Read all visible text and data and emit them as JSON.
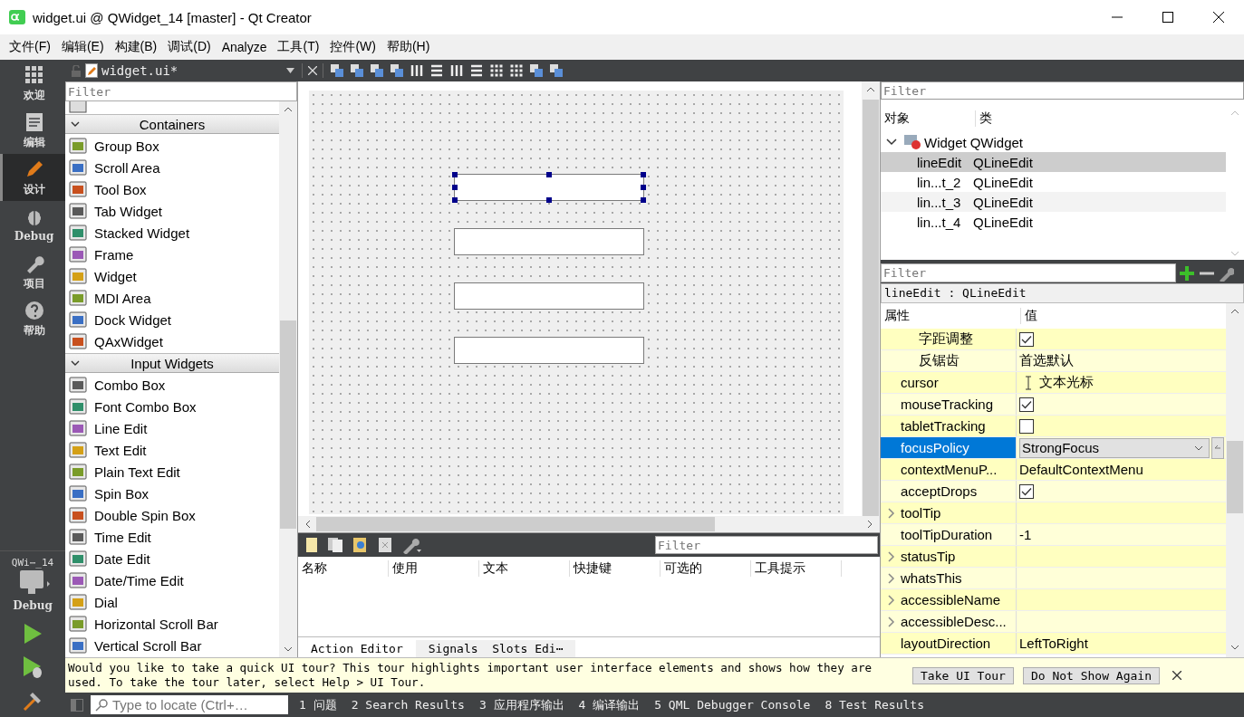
{
  "window": {
    "title": "widget.ui @ QWidget_14 [master] - Qt Creator"
  },
  "menu": [
    "文件(F)",
    "编辑(E)",
    "构建(B)",
    "调试(D)",
    "Analyze",
    "工具(T)",
    "控件(W)",
    "帮助(H)"
  ],
  "modes": [
    {
      "label": "欢迎",
      "selected": false
    },
    {
      "label": "编辑",
      "selected": false
    },
    {
      "label": "设计",
      "selected": true
    },
    {
      "label": "Debug",
      "selected": false
    },
    {
      "label": "项目",
      "selected": false
    },
    {
      "label": "帮助",
      "selected": false
    }
  ],
  "kit": {
    "project": "QWi⋯_14",
    "build": "Debug"
  },
  "editor": {
    "file": "widget.ui*"
  },
  "widget_box": {
    "filter_placeholder": "Filter",
    "categories": [
      {
        "name": "Containers",
        "expanded": true,
        "items": [
          "Group Box",
          "Scroll Area",
          "Tool Box",
          "Tab Widget",
          "Stacked Widget",
          "Frame",
          "Widget",
          "MDI Area",
          "Dock Widget",
          "QAxWidget"
        ]
      },
      {
        "name": "Input Widgets",
        "expanded": true,
        "items": [
          "Combo Box",
          "Font Combo Box",
          "Line Edit",
          "Text Edit",
          "Plain Text Edit",
          "Spin Box",
          "Double Spin Box",
          "Time Edit",
          "Date Edit",
          "Date/Time Edit",
          "Dial",
          "Horizontal Scroll Bar",
          "Vertical Scroll Bar"
        ]
      }
    ]
  },
  "form": {
    "line_edits": [
      {
        "selected": true
      },
      {
        "selected": false
      },
      {
        "selected": false
      },
      {
        "selected": false
      }
    ]
  },
  "action_editor": {
    "filter_placeholder": "Filter",
    "columns": [
      "名称",
      "使用",
      "文本",
      "快捷键",
      "可选的",
      "工具提示"
    ],
    "tabs": [
      {
        "label": "Action Editor",
        "selected": true
      },
      {
        "label": "Signals  Slots Edi⋯",
        "selected": false
      }
    ]
  },
  "object_inspector": {
    "filter_placeholder": "Filter",
    "columns": [
      "对象",
      "类"
    ],
    "root": {
      "name": "Widget",
      "class": "QWidget",
      "expanded": true,
      "children": [
        {
          "name": "lineEdit",
          "class": "QLineEdit",
          "selected": true
        },
        {
          "name": "lin...t_2",
          "class": "QLineEdit",
          "selected": false
        },
        {
          "name": "lin...t_3",
          "class": "QLineEdit",
          "selected": false
        },
        {
          "name": "lin...t_4",
          "class": "QLineEdit",
          "selected": false
        }
      ]
    }
  },
  "property_editor": {
    "filter_placeholder": "Filter",
    "object_label": "lineEdit : QLineEdit",
    "columns": [
      "属性",
      "值"
    ],
    "font_children": [
      {
        "name": "字距调整",
        "kind": "check",
        "checked": true
      },
      {
        "name": "反锯齿",
        "kind": "text",
        "value": "首选默认"
      }
    ],
    "rows": [
      {
        "name": "cursor",
        "kind": "cursor",
        "value": "文本光标",
        "selected": false
      },
      {
        "name": "mouseTracking",
        "kind": "check",
        "checked": true,
        "selected": false
      },
      {
        "name": "tabletTracking",
        "kind": "check",
        "checked": false,
        "selected": false
      },
      {
        "name": "focusPolicy",
        "kind": "combo",
        "value": "StrongFocus",
        "selected": true
      },
      {
        "name": "contextMenuP...",
        "kind": "text",
        "value": "DefaultContextMenu",
        "selected": false
      },
      {
        "name": "acceptDrops",
        "kind": "check",
        "checked": true,
        "selected": false
      },
      {
        "name": "toolTip",
        "kind": "empty",
        "expanded": false,
        "selected": false
      },
      {
        "name": "toolTipDuration",
        "kind": "text",
        "value": "-1",
        "selected": false
      },
      {
        "name": "statusTip",
        "kind": "empty",
        "expanded": false,
        "selected": false
      },
      {
        "name": "whatsThis",
        "kind": "empty",
        "expanded": false,
        "selected": false
      },
      {
        "name": "accessibleName",
        "kind": "empty",
        "expanded": false,
        "selected": false
      },
      {
        "name": "accessibleDesc...",
        "kind": "empty",
        "expanded": false,
        "selected": false
      },
      {
        "name": "layoutDirection",
        "kind": "text",
        "value": "LeftToRight",
        "selected": false
      }
    ]
  },
  "tour": {
    "message": "Would you like to take a quick UI tour? This tour highlights important user interface elements and shows how they are used. To take the tour later, select Help > UI Tour.",
    "buttons": [
      "Take UI Tour",
      "Do Not Show Again"
    ]
  },
  "status_bar": {
    "locate_placeholder": "Type to locate (Ctrl+…",
    "panes": [
      "1 问题",
      "2 Search Results",
      "3 应用程序输出",
      "4 编译输出",
      "5 QML Debugger Console",
      "8 Test Results"
    ]
  }
}
